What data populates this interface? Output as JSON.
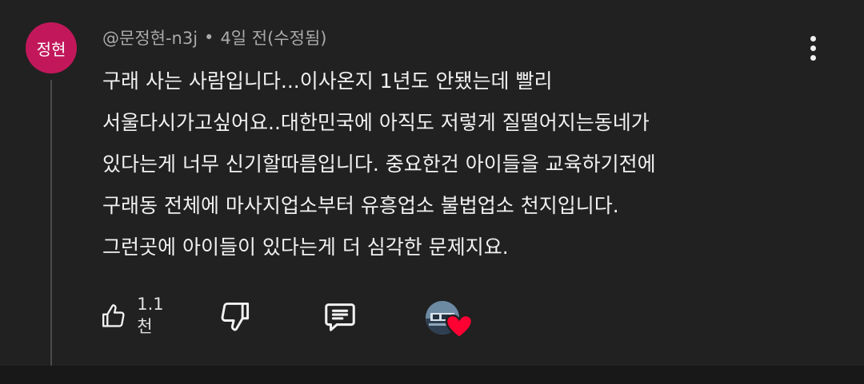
{
  "comment": {
    "avatar_text": "정현",
    "avatar_color": "#c2185b",
    "author": "@문정현-n3j",
    "separator": "•",
    "time": "4일 전(수정됨)",
    "body_lines": [
      "구래 사는 사람입니다...이사온지 1년도 안됐는데 빨리",
      "서울다시가고싶어요..대한민국에 아직도 저렇게 질떨어지는동네가",
      "있다는게 너무 신기할따름입니다. 중요한건 아이들을 교육하기전에",
      "구래동 전체에 마사지업소부터 유흥업소 불법업소 천지입니다.",
      "그런곳에 아이들이 있다는게 더 심각한 문제지요."
    ],
    "like_count": "1.1천",
    "icons": {
      "like": "thumbs-up-icon",
      "dislike": "thumbs-down-icon",
      "reply": "reply-icon",
      "more": "more-vert-icon",
      "creator_heart": "heart-icon"
    },
    "heart_color": "#ff0033"
  }
}
